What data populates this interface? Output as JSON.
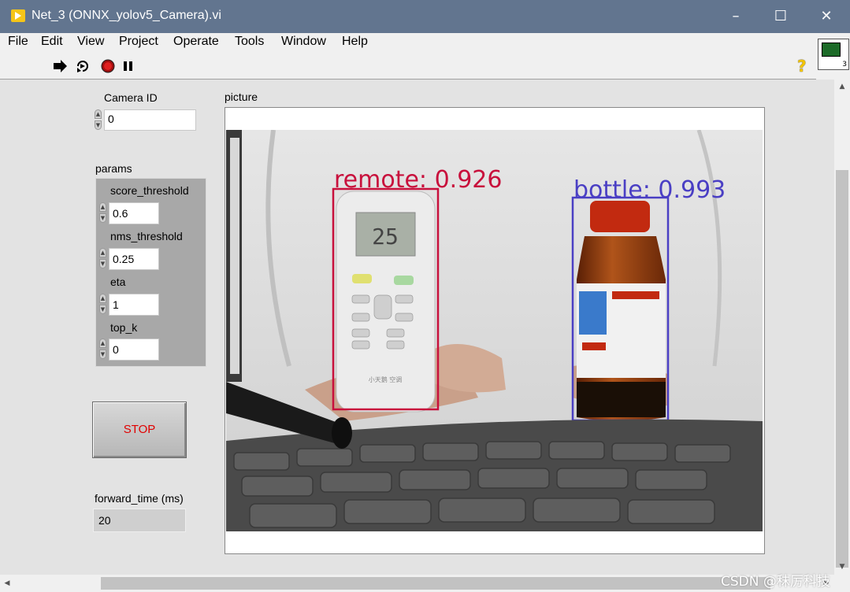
{
  "window": {
    "title": "Net_3 (ONNX_yolov5_Camera).vi",
    "minimize_glyph": "–",
    "maximize_glyph": "☐",
    "close_glyph": "✕"
  },
  "menu": [
    "File",
    "Edit",
    "View",
    "Project",
    "Operate",
    "Tools",
    "Window",
    "Help"
  ],
  "toolbar": {
    "run_icon": "run-arrow-icon",
    "run_continuous_icon": "run-continuously-icon",
    "abort_icon": "abort-stop-icon",
    "pause_icon": "pause-icon",
    "help_glyph": "?",
    "vi_icon_number": "3"
  },
  "panel": {
    "camera_id": {
      "label": "Camera ID",
      "value": "0"
    },
    "params": {
      "label": "params",
      "score_threshold": {
        "label": "score_threshold",
        "value": "0.6"
      },
      "nms_threshold": {
        "label": "nms_threshold",
        "value": "0.25"
      },
      "eta": {
        "label": "eta",
        "value": "1"
      },
      "top_k": {
        "label": "top_k",
        "value": "0"
      }
    },
    "stop_label": "STOP",
    "forward_time": {
      "label": "forward_time (ms)",
      "value": "20"
    },
    "picture_label": "picture"
  },
  "detections": [
    {
      "label": "remote: 0.926",
      "color": "#c8103c"
    },
    {
      "label": "bottle: 0.993",
      "color": "#4a3fc4"
    }
  ],
  "remote_display": "25",
  "remote_brand": "小天鹅 空调",
  "watermark": "CSDN @秣厉科技",
  "colors": {
    "titlebar": "#62758f",
    "panel": "#e3e3e3",
    "stop_text": "#e00000"
  }
}
